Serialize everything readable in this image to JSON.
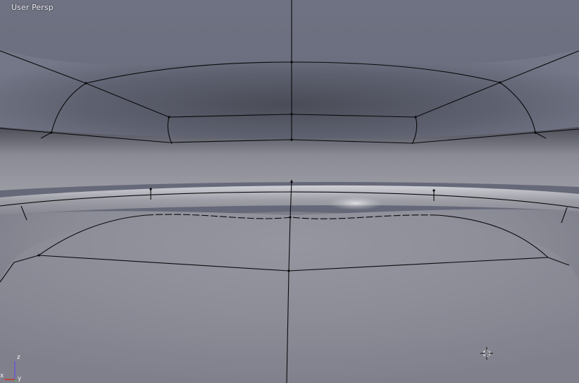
{
  "viewport": {
    "view_label": "User Persp",
    "axes": {
      "x": "x",
      "y": "y",
      "z": "z"
    },
    "colors": {
      "axis_x": "#c0392b",
      "axis_y": "#4caf50",
      "axis_z": "#6a5acd",
      "wire": "#0a0a0c"
    },
    "cursor": "3d-cursor-icon"
  }
}
